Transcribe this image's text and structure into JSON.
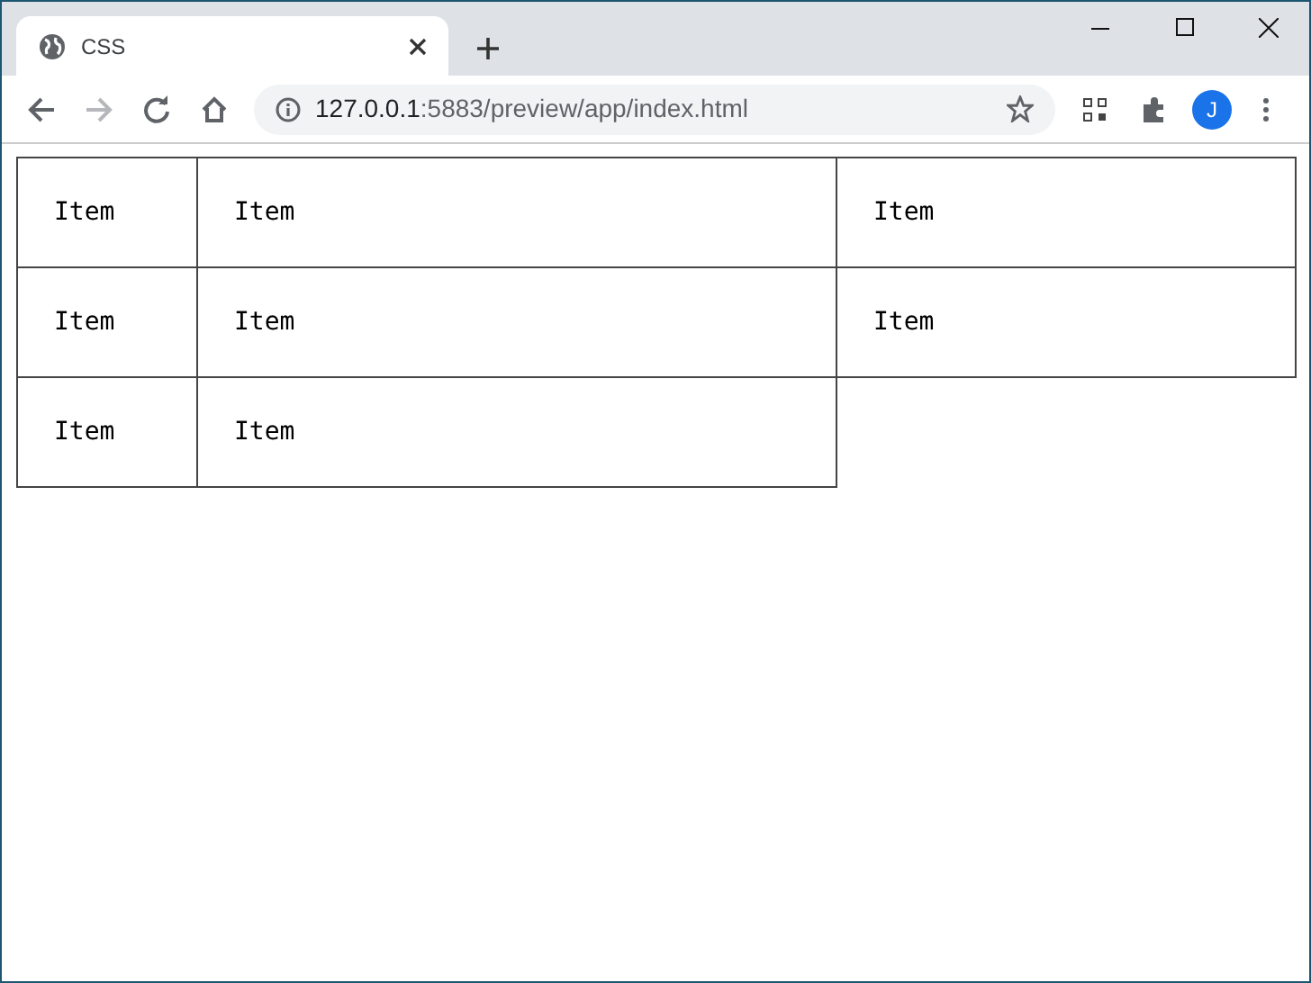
{
  "tab": {
    "title": "CSS",
    "selected": true
  },
  "address_bar": {
    "host": "127.0.0.1",
    "path": ":5883/preview/app/index.html"
  },
  "profile": {
    "initial": "J"
  },
  "grid": {
    "items": [
      {
        "label": "Item"
      },
      {
        "label": "Item"
      },
      {
        "label": "Item"
      },
      {
        "label": "Item"
      },
      {
        "label": "Item"
      },
      {
        "label": "Item"
      },
      {
        "label": "Item"
      },
      {
        "label": "Item"
      }
    ]
  }
}
